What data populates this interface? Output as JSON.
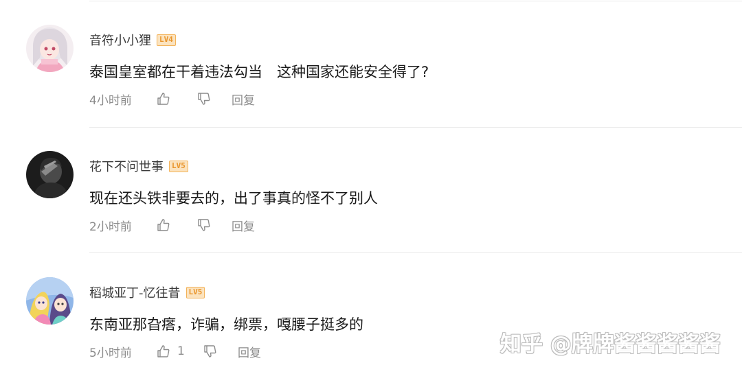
{
  "comments": [
    {
      "username": "音符小小狸",
      "level": "LV4",
      "text": "泰国皇室都在干着违法勾当　这种国家还能安全得了?",
      "time": "4小时前",
      "like_count": "",
      "reply_label": "回复",
      "avatar": "anime-girl-pink-hair"
    },
    {
      "username": "花下不问世事",
      "level": "LV5",
      "text": "现在还头铁非要去的，出了事真的怪不了别人",
      "time": "2小时前",
      "like_count": "",
      "reply_label": "回复",
      "avatar": "dark-figure-hand-on-face"
    },
    {
      "username": "稻城亚丁-忆往昔",
      "level": "LV5",
      "text": "东南亚那旮瘩，诈骗，绑票，嘎腰子挺多的",
      "time": "5小时前",
      "like_count": "1",
      "reply_label": "回复",
      "avatar": "anime-duo-colorful"
    }
  ],
  "icons": {
    "like": "thumbs-up-icon",
    "dislike": "thumbs-down-icon"
  },
  "watermark": "知乎 @牌牌酱酱酱酱酱",
  "colors": {
    "badge_border": "#f3b35a",
    "badge_fill": "#fbe3bf",
    "badge_text": "#e9952c",
    "meta_text": "#8c8c8c",
    "divider": "#e8e8e8"
  }
}
